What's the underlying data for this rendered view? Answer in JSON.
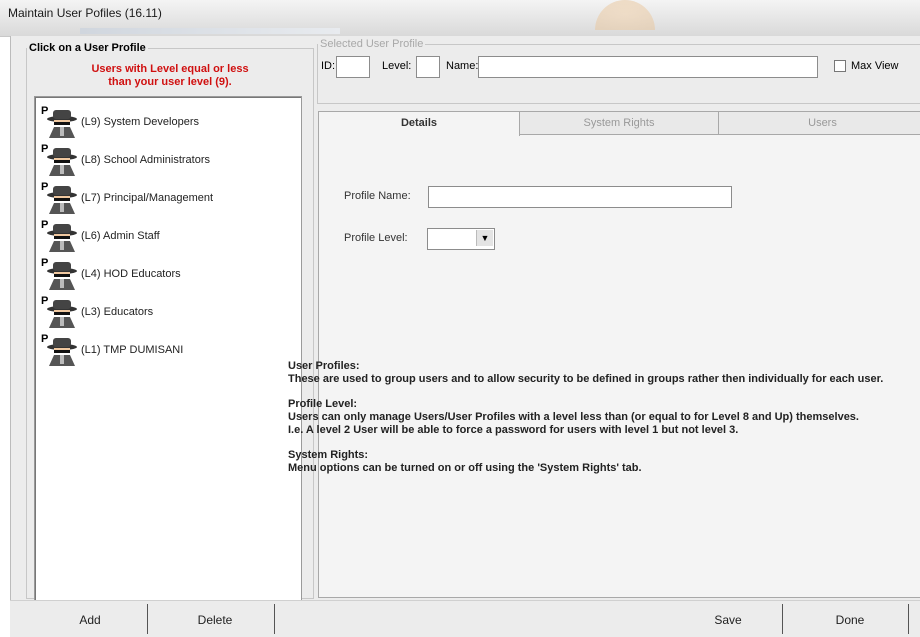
{
  "window": {
    "title": "Maintain User Pofiles (16.11)"
  },
  "left_panel": {
    "title": "Click on a User Profile",
    "hint_line1": "Users with Level equal or less",
    "hint_line2": "than your user level (9).",
    "profiles": [
      {
        "badge": "P",
        "label": "(L9) System Developers"
      },
      {
        "badge": "P",
        "label": "(L8) School Administrators"
      },
      {
        "badge": "P",
        "label": "(L7) Principal/Management"
      },
      {
        "badge": "P",
        "label": "(L6) Admin Staff"
      },
      {
        "badge": "P",
        "label": "(L4) HOD Educators"
      },
      {
        "badge": "P",
        "label": "(L3) Educators"
      },
      {
        "badge": "P",
        "label": "(L1) TMP DUMISANI"
      }
    ]
  },
  "selected_profile": {
    "title": "Selected User Profile",
    "id_label": "ID:",
    "id_value": "",
    "level_label": "Level:",
    "level_value": "",
    "name_label": "Name:",
    "name_value": "",
    "max_view_label": "Max View"
  },
  "tabs": [
    {
      "label": "Details",
      "active": true
    },
    {
      "label": "System Rights",
      "active": false
    },
    {
      "label": "Users",
      "active": false
    }
  ],
  "details": {
    "profile_name_label": "Profile Name:",
    "profile_name_value": "",
    "profile_level_label": "Profile Level:",
    "profile_level_value": "",
    "help": {
      "user_profiles_heading": "User Profiles:",
      "user_profiles_text": "These are used to group users and to allow security to be defined in groups rather then individually for each user.",
      "profile_level_heading": "Profile Level:",
      "profile_level_text": "Users can only manage Users/User Profiles with a level less than (or equal to for Level 8 and Up) themselves.",
      "profile_level_example": "I.e. A level 2 User will be able to force a password for users with level 1 but not level 3.",
      "system_rights_heading": "System Rights:",
      "system_rights_text": "Menu options can be turned on or off using the 'System Rights' tab."
    }
  },
  "buttons": {
    "add": "Add",
    "delete": "Delete",
    "save": "Save",
    "done": "Done"
  }
}
